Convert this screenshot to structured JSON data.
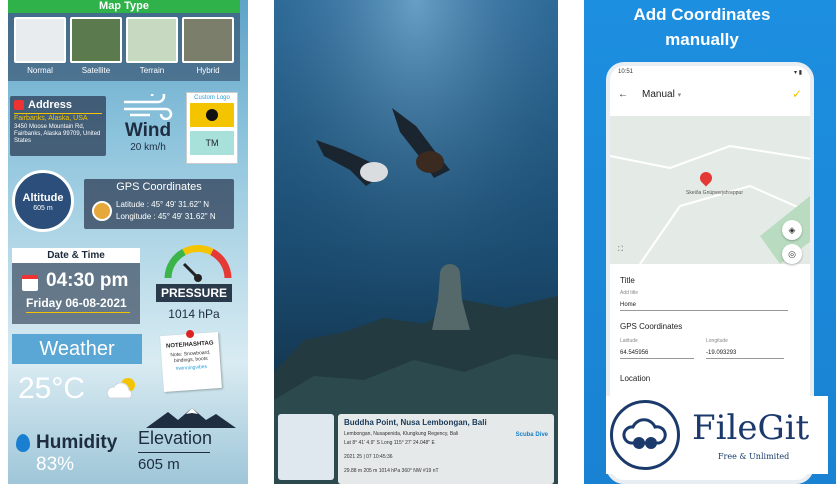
{
  "panel1": {
    "map_type_title": "Map Type",
    "map_types": [
      "Normal",
      "Satellite",
      "Terrain",
      "Hybrid"
    ],
    "address": {
      "title": "Address",
      "headline": "Fairbanks, Alaska, USA",
      "detail": "3450 Moose Mountain Rd, Fairbanks, Alaska 99709, United States"
    },
    "wind": {
      "label": "Wind",
      "value": "20 km/h"
    },
    "custom_logo": {
      "label": "Custom Logo",
      "tm": "TM"
    },
    "altitude": {
      "label": "Altitude",
      "value": "605 m"
    },
    "gps": {
      "title": "GPS Coordinates",
      "latitude": "Latitude : 45° 49' 31.62\" N",
      "longitude": "Longitude : 45° 49' 31.62\" N"
    },
    "datetime": {
      "title": "Date & Time",
      "time": "04:30 pm",
      "date": "Friday 06-08-2021"
    },
    "pressure": {
      "label": "PRESSURE",
      "value": "1014 hPa"
    },
    "weather": {
      "label": "Weather",
      "temp": "25°C"
    },
    "note": {
      "title": "NOTE/HASHTAG",
      "body": "Note: Snowboard, bindings, boots",
      "tag": "#winningvibes"
    },
    "humidity": {
      "label": "Humidity",
      "value": "83%"
    },
    "elevation": {
      "label": "Elevation",
      "value": "605 m"
    }
  },
  "panel2": {
    "place": "Buddha Point, Nusa Lembongan, Bali",
    "line1": "Lembongan, Nusapenida, Klungkung Regency, Bali",
    "line2": "Lat 8° 41' 4.9\" S  Long 115° 27' 24.048\" E",
    "line3": "2021 25 | 07 10:45:36",
    "line4": "29.88 m   205 m   1014 hPa   360° NW   #19 nT",
    "brand": "Scuba Dive"
  },
  "panel3": {
    "title_line1": "Add Coordinates",
    "title_line2": "manually",
    "status_time": "10:51",
    "toolbar_mode": "Manual",
    "map_place_label": "Skeiða Gnúpverjahreppur",
    "section_title": "Title",
    "add_title_label": "Add title",
    "title_value": "Home",
    "section_gps": "GPS Coordinates",
    "latitude_label": "Latitude",
    "latitude_value": "64.545956",
    "longitude_label": "Longitude",
    "longitude_value": "-19.093293",
    "section_location": "Location"
  },
  "watermark": {
    "name": "FileGit",
    "tagline": "Free & Unlimited"
  }
}
